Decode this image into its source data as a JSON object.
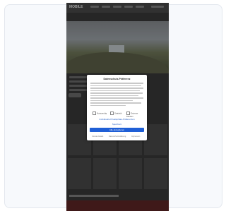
{
  "site": {
    "logo": "MOBILE",
    "nav": [
      "",
      "",
      "",
      "",
      ""
    ]
  },
  "consent": {
    "title": "Datenschutz-Präferenz",
    "checkboxes": [
      "Notwendig",
      "Statistik",
      "Externe Medien"
    ],
    "save_link": "Individuelle Privatsphäre-Präferenzen",
    "details_link": "Speichern",
    "accept_button": "Alle akzeptieren",
    "footer_links": [
      "Cookie-Details",
      "Datenschutzerklärung",
      "Impressum"
    ]
  }
}
